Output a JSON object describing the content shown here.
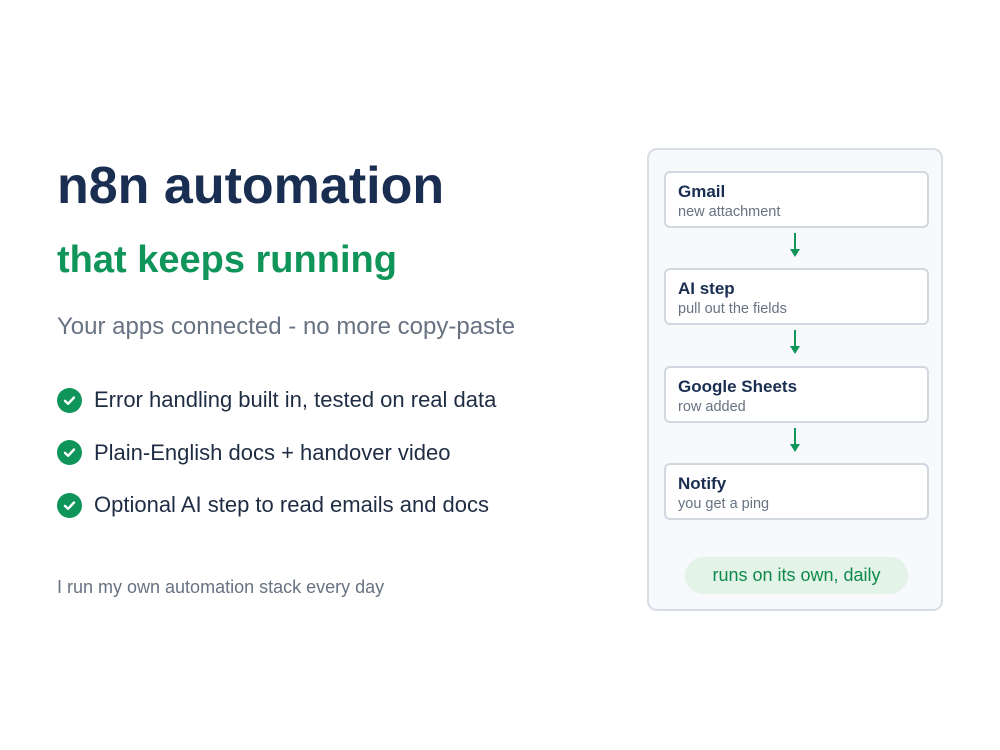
{
  "hero": {
    "title": "n8n automation",
    "subtitle": "that keeps running",
    "tagline": "Your apps connected - no more copy-paste",
    "features": [
      {
        "icon": "check-circle-icon",
        "text": "Error handling built in, tested on real data"
      },
      {
        "icon": "check-circle-icon",
        "text": "Plain-English docs + handover video"
      },
      {
        "icon": "check-circle-icon",
        "text": "Optional AI step to read emails and docs"
      }
    ],
    "footnote": "I run my own automation stack every day"
  },
  "workflow": {
    "steps": [
      {
        "name": "Gmail",
        "desc": "new attachment"
      },
      {
        "name": "AI step",
        "desc": "pull out the fields"
      },
      {
        "name": "Google Sheets",
        "desc": "row added"
      },
      {
        "name": "Notify",
        "desc": "you get a ping"
      }
    ],
    "arrow_icon": "arrow-down-icon",
    "status": "runs on its own, daily"
  },
  "colors": {
    "navy": "#1a2e52",
    "green": "#0f9559",
    "muted": "#677282",
    "pill_bg": "#e3f3e8"
  }
}
